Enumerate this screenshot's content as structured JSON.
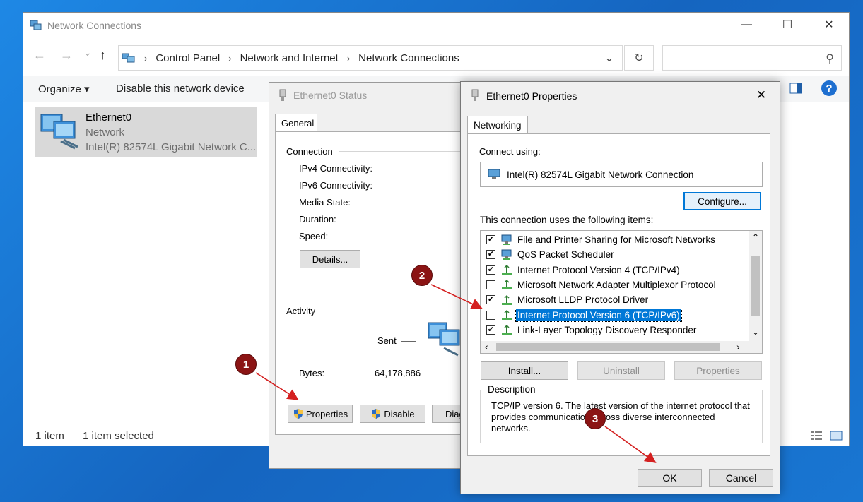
{
  "explorer": {
    "title": "Network Connections",
    "minimize": "—",
    "maximize": "☐",
    "close": "✕",
    "nav": {
      "back": "←",
      "forward": "→",
      "recent": "⌄",
      "up": "↑"
    },
    "breadcrumb": [
      "Control Panel",
      "Network and Internet",
      "Network Connections"
    ],
    "breadcrumb_sep": "›",
    "dropdown": "⌄",
    "refresh": "↻",
    "search_icon": "⚲",
    "commands": {
      "organize": "Organize ▾",
      "disable": "Disable this network device"
    },
    "adapter": {
      "name": "Ethernet0",
      "type": "Network",
      "device": "Intel(R) 82574L Gigabit Network C..."
    },
    "status": {
      "count": "1 item",
      "selected": "1 item selected"
    },
    "help": "?"
  },
  "status_dialog": {
    "title": "Ethernet0 Status",
    "tab": "General",
    "connection_label": "Connection",
    "fields": [
      "IPv4 Connectivity:",
      "IPv6 Connectivity:",
      "Media State:",
      "Duration:",
      "Speed:"
    ],
    "details_button": "Details...",
    "activity_label": "Activity",
    "sent_label": "Sent",
    "bytes_label": "Bytes:",
    "bytes_sent": "64,178,886",
    "properties_button": "Properties",
    "disable_button": "Disable",
    "diagnose_button": "Diag"
  },
  "props_dialog": {
    "title": "Ethernet0 Properties",
    "close": "✕",
    "tab": "Networking",
    "connect_using_label": "Connect using:",
    "adapter_name": "Intel(R) 82574L Gigabit Network Connection",
    "configure_button": "Configure...",
    "items_label": "This connection uses the following items:",
    "items": [
      {
        "label": "File and Printer Sharing for Microsoft Networks",
        "checked": true,
        "icon": "network-service-icon"
      },
      {
        "label": "QoS Packet Scheduler",
        "checked": true,
        "icon": "network-service-icon"
      },
      {
        "label": "Internet Protocol Version 4 (TCP/IPv4)",
        "checked": true,
        "icon": "protocol-icon"
      },
      {
        "label": "Microsoft Network Adapter Multiplexor Protocol",
        "checked": false,
        "icon": "protocol-icon"
      },
      {
        "label": "Microsoft LLDP Protocol Driver",
        "checked": true,
        "icon": "protocol-icon"
      },
      {
        "label": "Internet Protocol Version 6 (TCP/IPv6)",
        "checked": false,
        "selected": true,
        "icon": "protocol-icon"
      },
      {
        "label": "Link-Layer Topology Discovery Responder",
        "checked": true,
        "icon": "protocol-icon"
      }
    ],
    "install_button": "Install...",
    "uninstall_button": "Uninstall",
    "properties_button": "Properties",
    "description_label": "Description",
    "description_text": "TCP/IP version 6. The latest version of the internet protocol that provides communication across diverse interconnected networks.",
    "ok_button": "OK",
    "cancel_button": "Cancel",
    "scroll_up": "⌃",
    "scroll_down": "⌄",
    "scroll_left": "‹",
    "scroll_right": "›"
  },
  "annotations": [
    "1",
    "2",
    "3"
  ],
  "colors": {
    "accent": "#0078d7",
    "badge": "#8b1414",
    "arrow": "#d42020"
  }
}
